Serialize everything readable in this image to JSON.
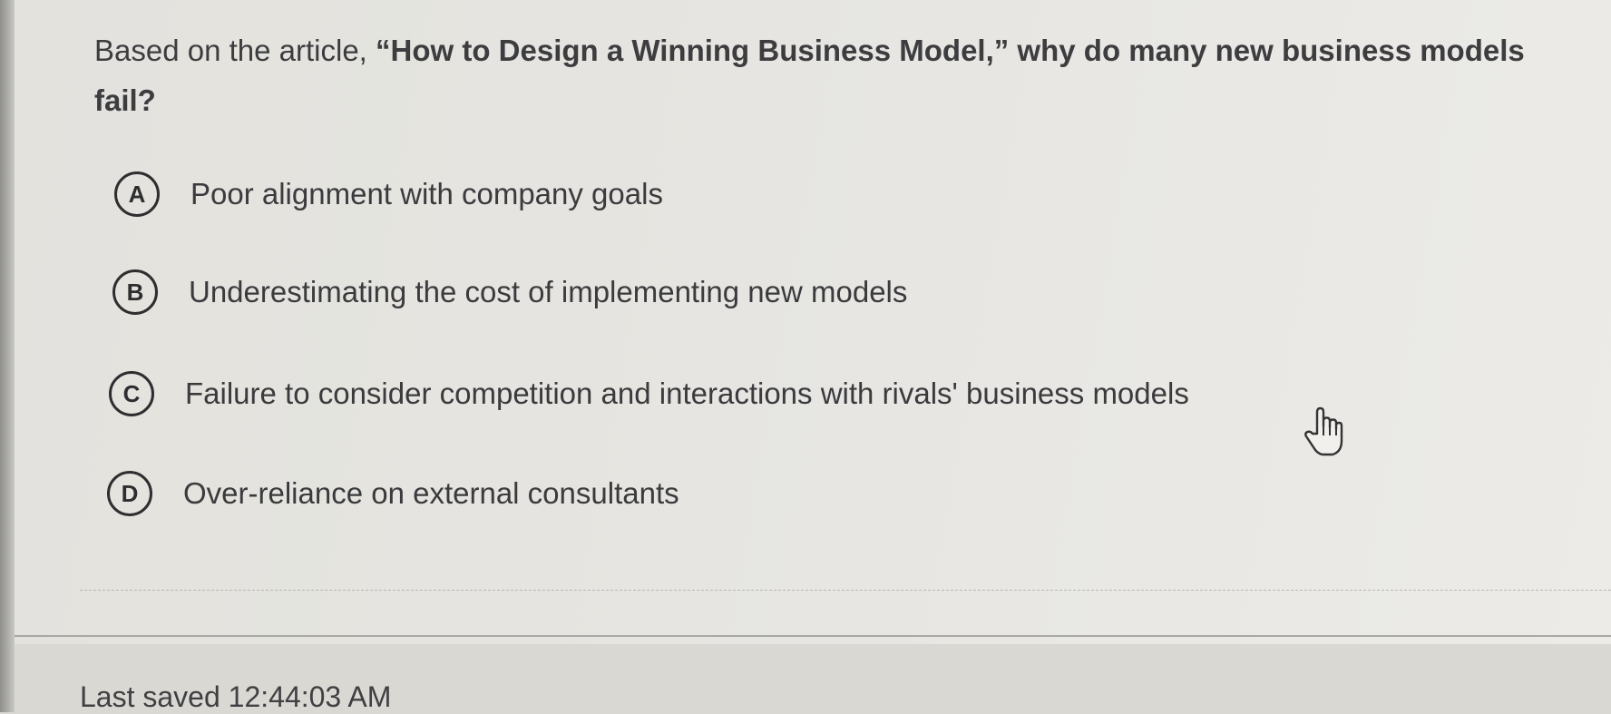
{
  "question": {
    "prefix": "Based on the article, ",
    "title": "“How to Design a Winning Business Model,” why do many new business models fail?"
  },
  "options": [
    {
      "letter": "A",
      "text": "Poor alignment with company goals"
    },
    {
      "letter": "B",
      "text": "Underestimating the cost of implementing new models"
    },
    {
      "letter": "C",
      "text": "Failure to consider competition and interactions with rivals' business models"
    },
    {
      "letter": "D",
      "text": "Over-reliance on external consultants"
    }
  ],
  "footer": {
    "last_saved": "Last saved 12:44:03 AM"
  },
  "cursor_icon": "hand-pointer-icon"
}
